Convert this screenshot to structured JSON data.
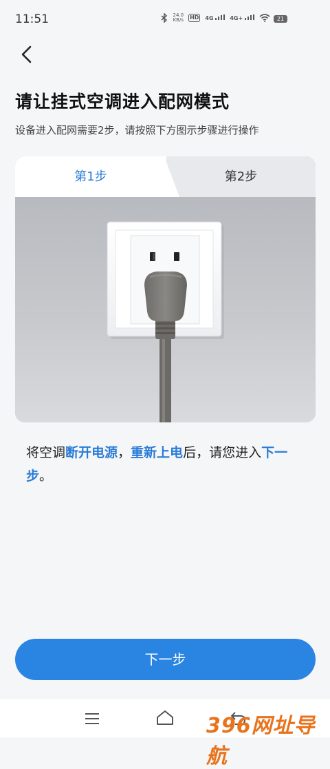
{
  "status_bar": {
    "time": "11:51",
    "net_speed_value": "24.0",
    "net_speed_unit": "KB/s",
    "hd_label": "HD",
    "sim1_label": "4G",
    "sim2_label": "4G+",
    "battery": "21"
  },
  "header": {
    "title": "请让挂式空调进入配网模式",
    "subtitle": "设备进入配网需要2步，请按照下方图示步骤进行操作"
  },
  "tabs": [
    {
      "label": "第1步",
      "active": true
    },
    {
      "label": "第2步",
      "active": false
    }
  ],
  "instruction": {
    "part1": "将空调",
    "hl1": "断开电源",
    "part2": "，",
    "hl2": "重新上电",
    "part3": "后，请您进入",
    "hl3": "下一步",
    "part4": "。"
  },
  "next_button": "下一步",
  "watermark": "396网址导航",
  "colors": {
    "accent": "#2a84e2",
    "highlight": "#2a7cd6",
    "background": "#f5f6f8"
  }
}
